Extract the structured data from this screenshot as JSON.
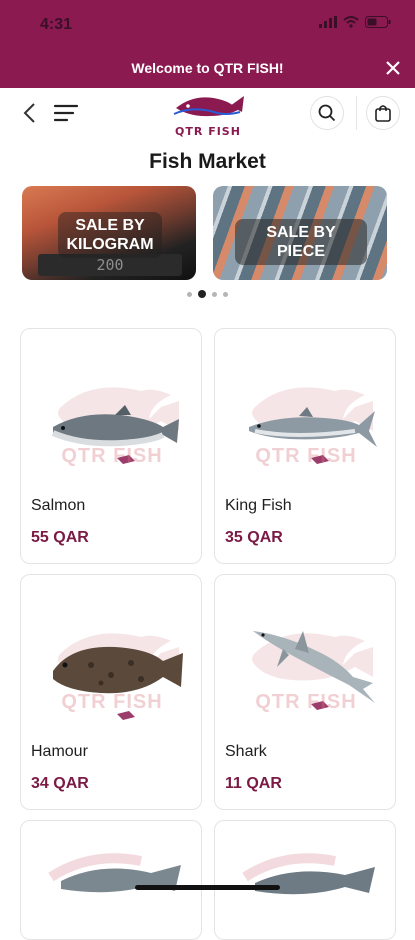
{
  "status_bar": {
    "time": "4:31"
  },
  "announcement": {
    "text": "Welcome to QTR FISH!"
  },
  "nav": {
    "logo_text": "QTR FISH"
  },
  "page": {
    "title": "Fish Market"
  },
  "banners": [
    {
      "label": "SALE BY KILOGRAM",
      "scale_reading": "200"
    },
    {
      "label": "SALE BY PIECE"
    }
  ],
  "carousel": {
    "count": 4,
    "active": 1
  },
  "watermark": "QTR FISH",
  "products": [
    {
      "name": "Salmon",
      "price": "55 QAR"
    },
    {
      "name": "King Fish",
      "price": "35 QAR"
    },
    {
      "name": "Hamour",
      "price": "34 QAR"
    },
    {
      "name": "Shark",
      "price": "11 QAR"
    }
  ],
  "colors": {
    "brand": "#8b1a50",
    "price": "#7a1a45"
  }
}
